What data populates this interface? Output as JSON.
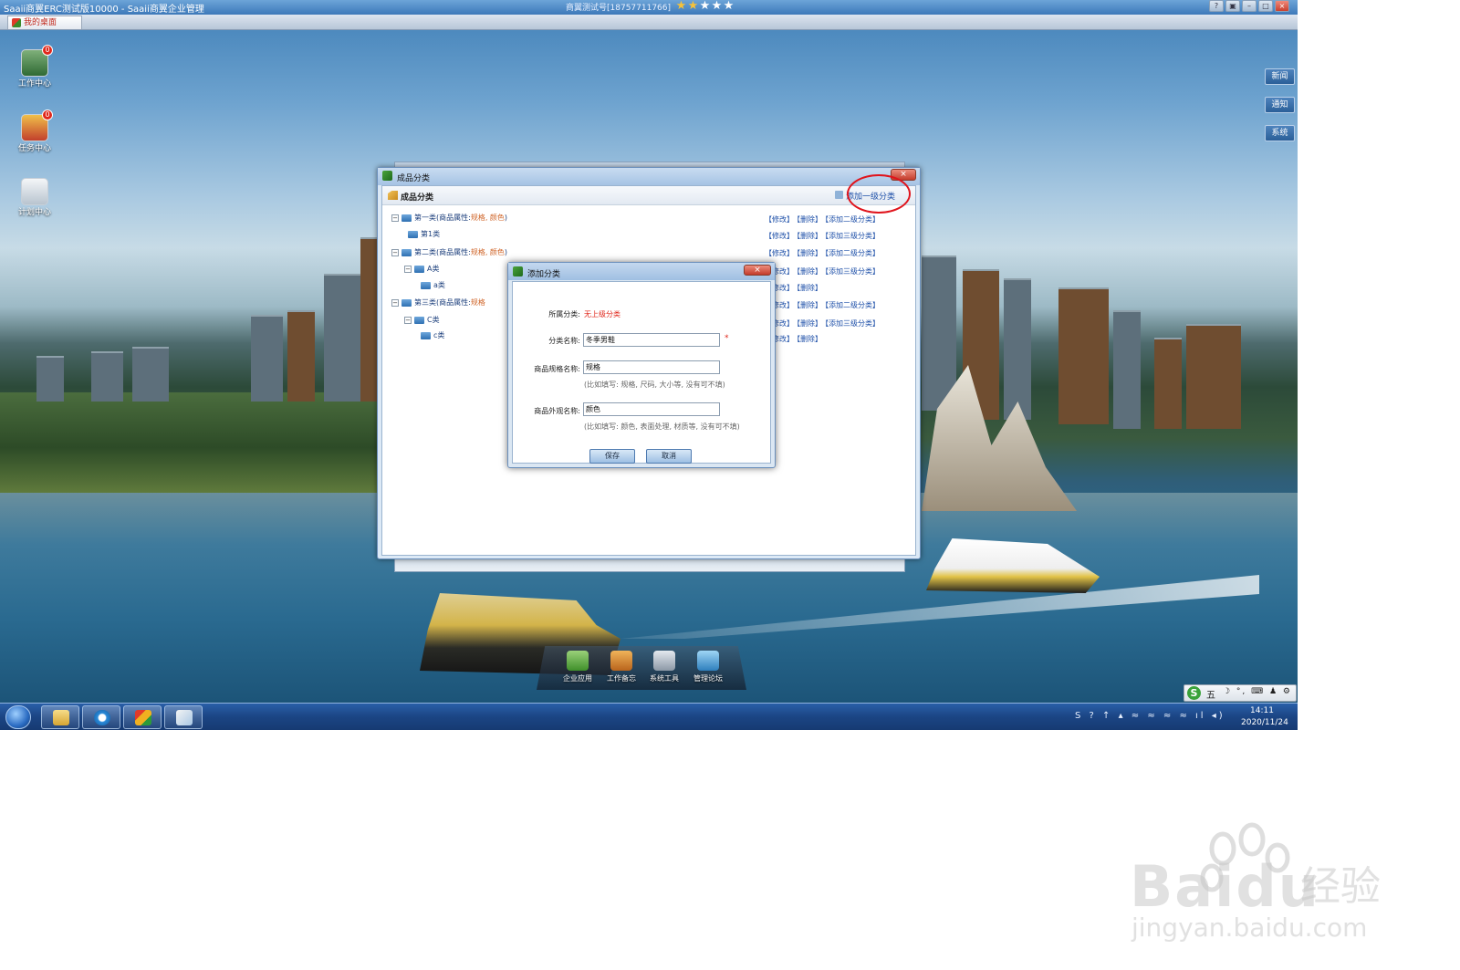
{
  "titlebar": {
    "app_title": "Saaii商翼ERC测试版10000 - Saaii商翼企业管理",
    "center_status": "商翼测试号[18757711766]",
    "stars": [
      "★",
      "★",
      "★",
      "★",
      "★"
    ],
    "window_controls": [
      "?",
      "▣",
      "–",
      "□",
      "×"
    ]
  },
  "subbar": {
    "tab_label": "我的桌面"
  },
  "desktop_icons": [
    {
      "label": "工作中心",
      "badge": "0"
    },
    {
      "label": "任务中心",
      "badge": "0"
    },
    {
      "label": "计划中心"
    }
  ],
  "side_buttons": [
    "新闻",
    "通知",
    "系统"
  ],
  "main_window": {
    "title": "成品分类",
    "close_label": "×",
    "panel_title": "成品分类",
    "add_first_level": "添加一级分类"
  },
  "tree": [
    {
      "toggle": "−",
      "name": "第一类",
      "attr_prefix": "(商品属性:",
      "attr_value": "规格, 颜色",
      "attr_suffix": ")",
      "actions": [
        "【修改】",
        "【删除】",
        "【添加二级分类】"
      ]
    },
    {
      "name": "第1类",
      "actions": [
        "【修改】",
        "【删除】",
        "【添加三级分类】"
      ]
    },
    {
      "toggle": "−",
      "name": "第二类",
      "attr_prefix": "(商品属性:",
      "attr_value": "规格, 颜色",
      "attr_suffix": ")",
      "actions": [
        "【修改】",
        "【删除】",
        "【添加二级分类】"
      ]
    },
    {
      "toggle": "−",
      "name": "A类",
      "actions": [
        "【修改】",
        "【删除】",
        "【添加三级分类】"
      ]
    },
    {
      "name": "a类",
      "actions": [
        "【修改】",
        "【删除】"
      ]
    },
    {
      "toggle": "−",
      "name": "第三类",
      "attr_prefix": "(商品属性:",
      "attr_value": "规格",
      "attr_suffix": "",
      "actions": [
        "【修改】",
        "【删除】",
        "【添加二级分类】"
      ]
    },
    {
      "toggle": "−",
      "name": "C类",
      "actions": [
        "【修改】",
        "【删除】",
        "【添加三级分类】"
      ]
    },
    {
      "name": "c类",
      "actions": [
        "【修改】",
        "【删除】"
      ]
    }
  ],
  "dialog": {
    "title": "添加分类",
    "close_label": "×",
    "parent_label": "所属分类:",
    "parent_value": "无上级分类",
    "name_label": "分类名称:",
    "name_value": "冬季男鞋",
    "required_mark": "*",
    "spec_label": "商品规格名称:",
    "spec_value": "规格",
    "spec_hint": "(比如填写: 规格, 尺码, 大小等, 没有可不填)",
    "appearance_label": "商品外观名称:",
    "appearance_value": "颜色",
    "appearance_hint": "(比如填写: 颜色, 表面处理, 材质等, 没有可不填)",
    "save_label": "保存",
    "cancel_label": "取消"
  },
  "dock": [
    "企业应用",
    "工作备忘",
    "系统工具",
    "管理论坛"
  ],
  "ime": {
    "logo": "S",
    "mode": "五",
    "glyphs": "☽ °, ⌨ ♟ ⚙"
  },
  "taskbar": {
    "tray": "S ? ↑ ▴ ≈ ≈ ≈ ≈ ıl ◂)",
    "time": "14:11",
    "date": "2020/11/24"
  },
  "watermark": {
    "brand": "Bai",
    "brand2": "du",
    "cn": "经验",
    "url": "jingyan.baidu.com"
  }
}
